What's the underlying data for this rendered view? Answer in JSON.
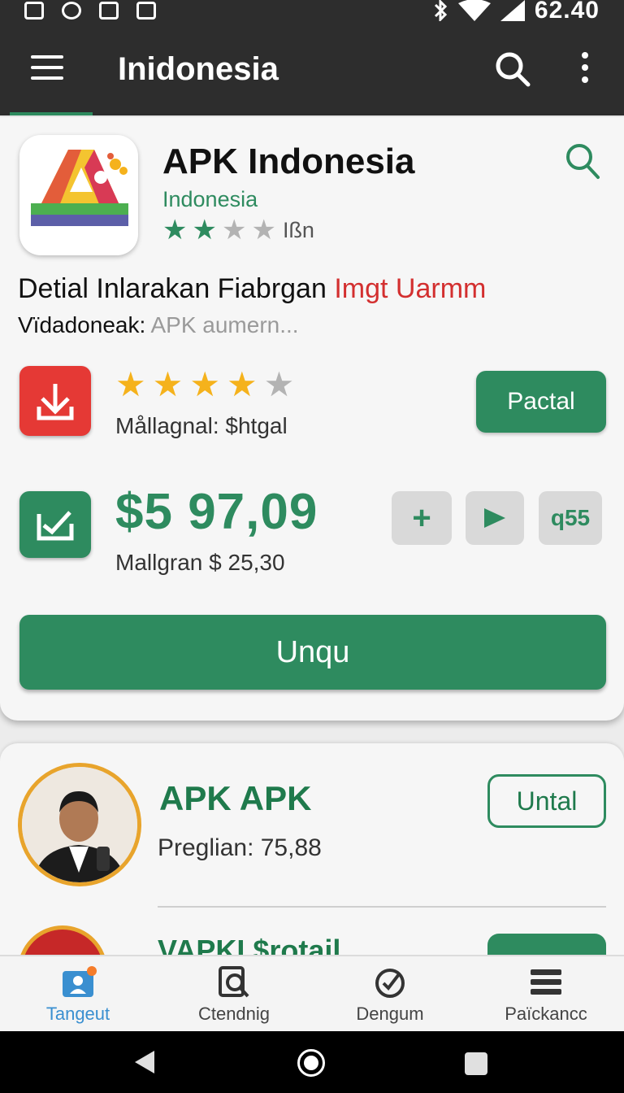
{
  "status_bar": {
    "time": "62.40"
  },
  "app_bar": {
    "title": "Inidonesia"
  },
  "app": {
    "name": "APK Indonesia",
    "subtitle": "Indonesia",
    "rating_label": "Ißn",
    "small_rating_stars": 2,
    "detail_text": "Detial Inlarakan Fiabrgan",
    "detail_highlight": "Imgt Uarmm",
    "vida_label": "Vïdadoneak:",
    "vida_value": "APK aumern...",
    "rating_stars": 4,
    "mall_text": "Mållagnal: $htgal",
    "pactal_label": "Pactal",
    "price": "$5 97,09",
    "mall_price": "Mallgran $ 25,30",
    "plus_label": "+",
    "count_label": "q55",
    "primary_label": "Unqu"
  },
  "list": {
    "items": [
      {
        "title": "APK APK",
        "subtitle": "Preglian: 75,88",
        "button": "Untal"
      },
      {
        "title": "VAPKI $rotail",
        "button": ""
      }
    ]
  },
  "bottom_nav": {
    "items": [
      {
        "label": "Tangeut",
        "icon": "person-badge-icon"
      },
      {
        "label": "Ctendnig",
        "icon": "search-doc-icon"
      },
      {
        "label": "Dengum",
        "icon": "check-circle-icon"
      },
      {
        "label": "Païckancc",
        "icon": "stack-icon"
      }
    ]
  },
  "colors": {
    "primary_green": "#2e8b5f",
    "dark_bar": "#2d2d2d",
    "accent_red": "#d32f2f",
    "star_yellow": "#f5b21c",
    "avatar_ring": "#e8a42c"
  }
}
